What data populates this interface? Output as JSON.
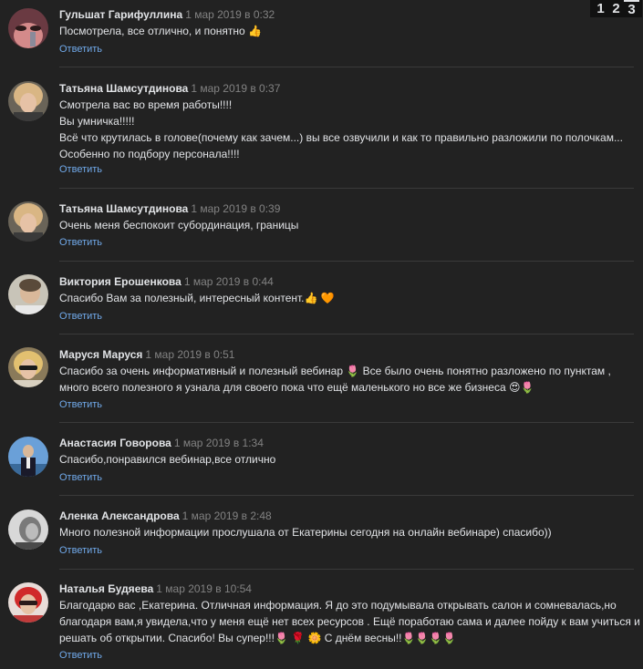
{
  "pagination": {
    "pages": [
      "1",
      "2",
      "3"
    ],
    "current": "3"
  },
  "reply_label": "Ответить",
  "comments": [
    {
      "author": "Гульшат Гарифуллина",
      "date": "1 мар 2019 в 0:32",
      "lines": [
        "Посмотрела, все отлично, и понятно 👍"
      ],
      "avatar_color": "#c9707a"
    },
    {
      "author": "Татьяна Шамсутдинова",
      "date": "1 мар 2019 в 0:37",
      "lines": [
        "Смотрела вас во время работы!!!!",
        "Вы умничка!!!!!",
        "Всё что крутилась в голове(почему как зачем...) вы все озвучили и как то правильно разложили по полочкам...",
        "Особенно по подбору персонала!!!!"
      ],
      "avatar_color": "#b99a7a"
    },
    {
      "author": "Татьяна Шамсутдинова",
      "date": "1 мар 2019 в 0:39",
      "lines": [
        "Очень меня беспокоит субординация, границы"
      ],
      "avatar_color": "#b99a7a"
    },
    {
      "author": "Виктория Ерошенкова",
      "date": "1 мар 2019 в 0:44",
      "lines": [
        "Спасибо Вам за полезный, интересный контент.👍 🧡"
      ],
      "avatar_color": "#a8a49a"
    },
    {
      "author": "Маруся Маруся",
      "date": "1 мар 2019 в 0:51",
      "lines": [
        "Спасибо за очень информативный и полезный вебинар 🌷 Все было очень понятно разложено по пунктам ,",
        "много всего полезного я узнала для своего пока что ещё маленького но все же бизнеса 😍🌷"
      ],
      "avatar_color": "#c9a060"
    },
    {
      "author": "Анастасия Говорова",
      "date": "1 мар 2019 в 1:34",
      "lines": [
        "Спасибо,понравился вебинар,все отлично"
      ],
      "avatar_color": "#4a6a9a"
    },
    {
      "author": "Аленка Александрова",
      "date": "1 мар 2019 в 2:48",
      "lines": [
        "Много полезной информации прослушала от Екатерины сегодня на онлайн вебинаре) спасибо))"
      ],
      "avatar_color": "#9a9a9a"
    },
    {
      "author": "Наталья Будяева",
      "date": "1 мар 2019 в 10:54",
      "lines": [
        "Благодарю вас ,Екатерина. Отличная информация. Я до это подумывала открывать салон и сомневалась,но",
        "благодаря вам,я увидела,что у меня ещё нет всех ресурсов . Ещё поработаю сама и далее пойду к вам учиться и",
        "решать об открытии. Спасибо! Вы супер!!!🌷 🌹 🌼 С днём весны!!🌷🌷🌷🌷"
      ],
      "avatar_color": "#c8504a"
    }
  ]
}
